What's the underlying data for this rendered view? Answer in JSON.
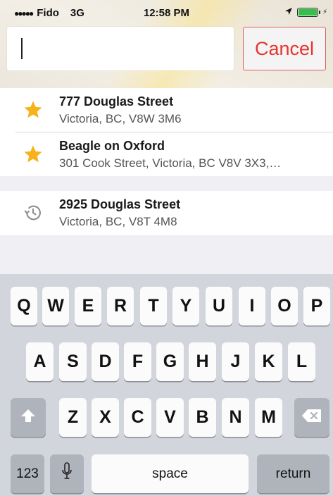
{
  "status_bar": {
    "carrier": "Fido",
    "network": "3G",
    "time": "12:58 PM",
    "battery_color": "#32c14a"
  },
  "search": {
    "value": "",
    "cancel_label": "Cancel",
    "accent_color": "#e8342f"
  },
  "favorites": [
    {
      "icon": "star-icon",
      "title": "777 Douglas Street",
      "subtitle": "Victoria, BC, V8W 3M6"
    },
    {
      "icon": "star-icon",
      "title": "Beagle on Oxford",
      "subtitle": "301 Cook Street, Victoria, BC V8V 3X3,…"
    }
  ],
  "recents": [
    {
      "icon": "history-icon",
      "title": "2925 Douglas Street",
      "subtitle": "Victoria, BC, V8T 4M8"
    }
  ],
  "keyboard": {
    "row1": [
      "Q",
      "W",
      "E",
      "R",
      "T",
      "Y",
      "U",
      "I",
      "O",
      "P"
    ],
    "row2": [
      "A",
      "S",
      "D",
      "F",
      "G",
      "H",
      "J",
      "K",
      "L"
    ],
    "row3": [
      "Z",
      "X",
      "C",
      "V",
      "B",
      "N",
      "M"
    ],
    "numbers_label": "123",
    "space_label": "space",
    "return_label": "return",
    "shift_icon": "shift-icon",
    "delete_icon": "delete-icon",
    "mic_icon": "microphone-icon"
  }
}
